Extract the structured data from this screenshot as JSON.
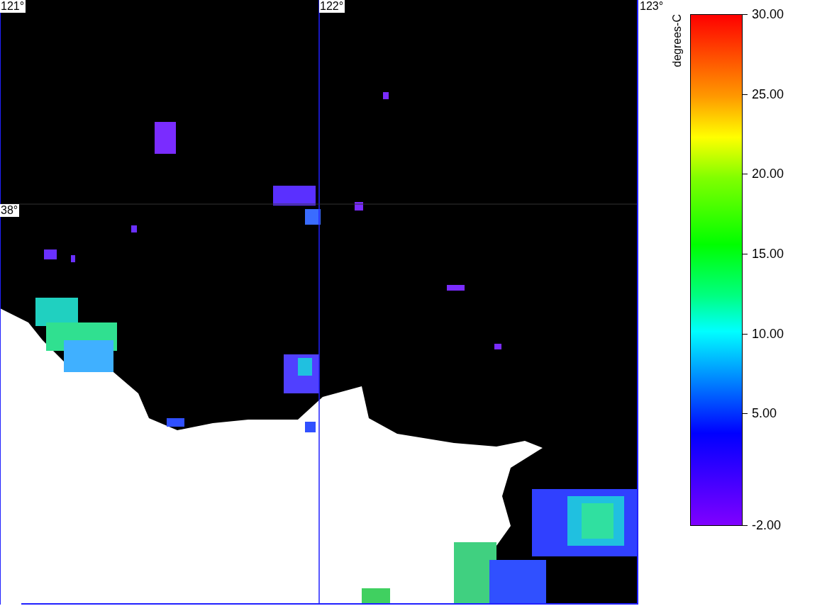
{
  "map": {
    "longitude_labels": [
      "121°",
      "122°",
      "123°"
    ],
    "latitude_labels": [
      "38°"
    ]
  },
  "colorbar": {
    "unit": "degrees-C",
    "ticks": [
      {
        "label": "30.00",
        "level": 1
      },
      {
        "label": "25.00",
        "level": 0.84375
      },
      {
        "label": "20.00",
        "level": 0.6875
      },
      {
        "label": "15.00",
        "level": 0.53125
      },
      {
        "label": "10.00",
        "level": 0.375
      },
      {
        "label": "5.00",
        "level": 0.21875
      },
      {
        "label": "-2.00",
        "level": 0
      }
    ]
  }
}
